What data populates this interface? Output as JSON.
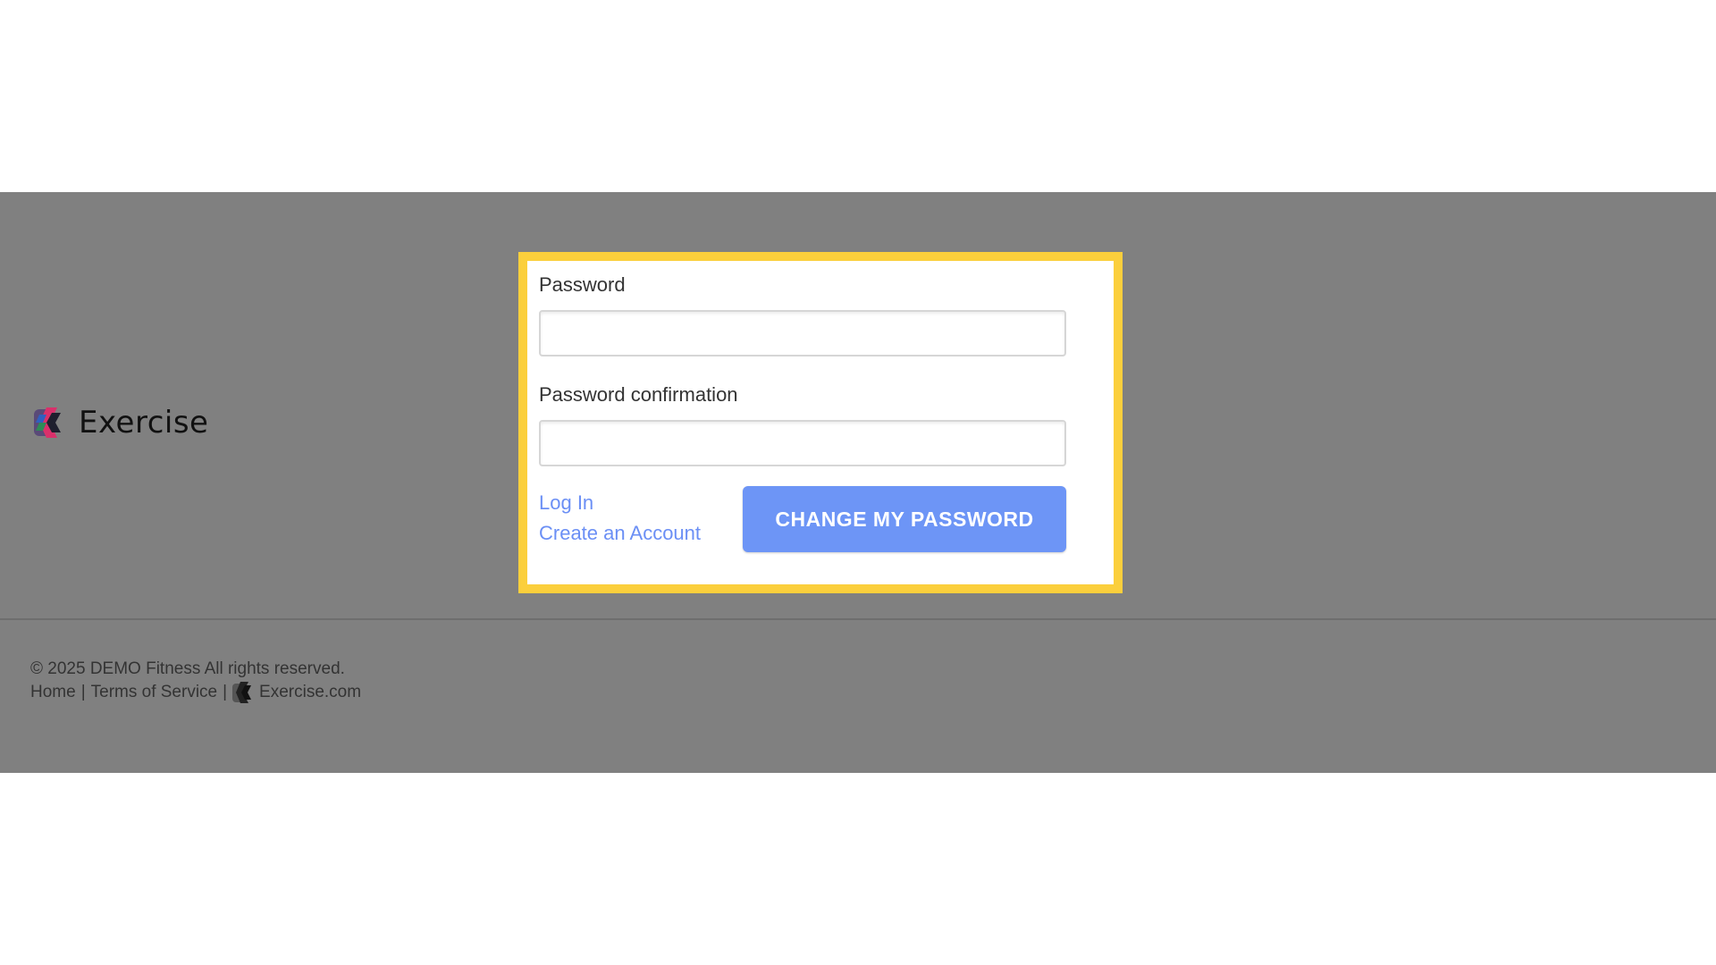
{
  "header": {
    "brand_name": "Exercise",
    "logo_icon": "exercise-logo-icon"
  },
  "form": {
    "password_label": "Password",
    "password_value": "",
    "password_placeholder": "",
    "confirmation_label": "Password confirmation",
    "confirmation_value": "",
    "confirmation_placeholder": "",
    "login_link": "Log In",
    "create_account_link": "Create an Account",
    "submit_label": "CHANGE MY PASSWORD"
  },
  "footer": {
    "copyright": "© 2025 DEMO Fitness All rights reserved.",
    "links": {
      "home": "Home",
      "separator": "|",
      "terms": "Terms of Service",
      "exercise_site": "Exercise.com"
    }
  },
  "colors": {
    "overlay": "#808080",
    "highlight": "#fbcf3c",
    "link": "#6b8ff5",
    "button": "#6d95f6"
  }
}
